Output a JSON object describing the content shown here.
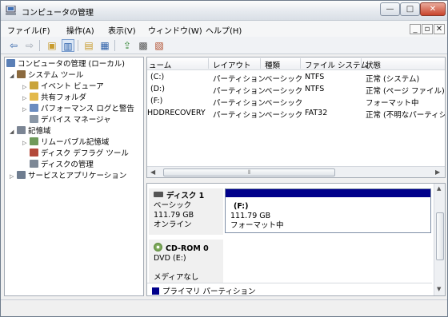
{
  "window": {
    "title": "コンピュータの管理"
  },
  "menu": {
    "items": [
      "ファイル(F)",
      "操作(A)",
      "表示(V)",
      "ウィンドウ(W)",
      "ヘルプ(H)"
    ]
  },
  "toolbar": {
    "buttons": [
      "back-arrow",
      "forward-arrow",
      "up-folder",
      "show-tree",
      "properties",
      "help",
      "export",
      "settings",
      "disk-tool"
    ]
  },
  "tree": {
    "root": "コンピュータの管理 (ローカル)",
    "system_tools": "システム ツール",
    "event_viewer": "イベント ビューア",
    "shared_folders": "共有フォルダ",
    "perf_logs": "パフォーマンス ログと警告",
    "device_manager": "デバイス マネージャ",
    "storage": "記憶域",
    "removable": "リムーバブル記憶域",
    "defrag": "ディスク デフラグ ツール",
    "disk_mgmt": "ディスクの管理",
    "services": "サービスとアプリケーション"
  },
  "volume_list": {
    "columns": [
      "ューム",
      "レイアウト",
      "種類",
      "ファイル システム",
      "状態"
    ],
    "rows": [
      [
        "(C:)",
        "パーティション",
        "ベーシック",
        "NTFS",
        "正常 (システム)"
      ],
      [
        "(D:)",
        "パーティション",
        "ベーシック",
        "NTFS",
        "正常 (ページ ファイル)"
      ],
      [
        "(F:)",
        "パーティション",
        "ベーシック",
        "",
        "フォーマット中"
      ],
      [
        "HDDRECOVERY",
        "パーティション",
        "ベーシック",
        "FAT32",
        "正常 (不明なパーティシ"
      ]
    ]
  },
  "disks": {
    "disk1": {
      "name": "ディスク 1",
      "type": "ベーシック",
      "size": "111.79 GB",
      "status": "オンライン",
      "volume": {
        "label": "(F:)",
        "size": "111.79 GB",
        "status": "フォーマット中"
      }
    },
    "cdrom0": {
      "name": "CD-ROM 0",
      "drive": "DVD (E:)",
      "media": "メディアなし"
    }
  },
  "legend": {
    "primary_partition": "プライマリ パーティション",
    "color": "#00008b"
  }
}
